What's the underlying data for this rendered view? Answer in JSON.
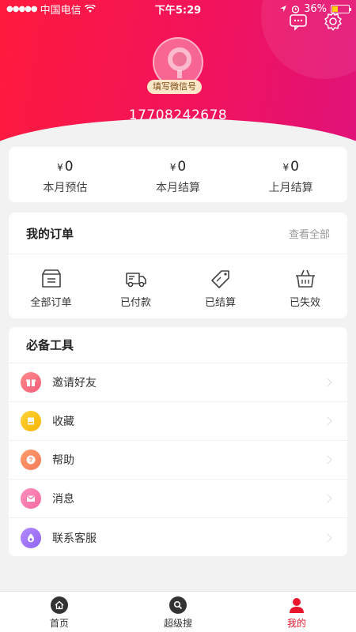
{
  "status_bar": {
    "carrier": "中国电信",
    "time": "下午5:29",
    "battery": "36%",
    "battery_level": 0.36
  },
  "header": {
    "wechat_pill": "填写微信号",
    "phone": "17708242678",
    "icons": [
      "message-icon",
      "settings-icon"
    ]
  },
  "stats": [
    {
      "currency": "¥",
      "amount": "0",
      "label": "本月预估"
    },
    {
      "currency": "¥",
      "amount": "0",
      "label": "本月结算"
    },
    {
      "currency": "¥",
      "amount": "0",
      "label": "上月结算"
    }
  ],
  "orders": {
    "title": "我的订单",
    "view_all": "查看全部",
    "items": [
      {
        "label": "全部订单",
        "icon": "box-icon"
      },
      {
        "label": "已付款",
        "icon": "truck-icon"
      },
      {
        "label": "已结算",
        "icon": "tag-icon"
      },
      {
        "label": "已失效",
        "icon": "basket-icon"
      }
    ]
  },
  "tools": {
    "title": "必备工具",
    "items": [
      {
        "label": "邀请好友",
        "icon": "gift-icon",
        "color": "#f25d7a"
      },
      {
        "label": "收藏",
        "icon": "bookmark-icon",
        "color": "#f5b400"
      },
      {
        "label": "帮助",
        "icon": "help-icon",
        "color": "#f37a5a"
      },
      {
        "label": "消息",
        "icon": "mail-icon",
        "color": "#f56aa0"
      },
      {
        "label": "联系客服",
        "icon": "service-icon",
        "color": "#8e63f0"
      }
    ]
  },
  "tabbar": {
    "items": [
      {
        "label": "首页",
        "icon": "home-icon",
        "active": false
      },
      {
        "label": "超级搜",
        "icon": "search-icon",
        "active": false
      },
      {
        "label": "我的",
        "icon": "user-icon",
        "active": true
      }
    ]
  },
  "colors": {
    "brand_red": "#e8152c",
    "header_start": "#ff1a3d",
    "header_end": "#e0127a"
  }
}
